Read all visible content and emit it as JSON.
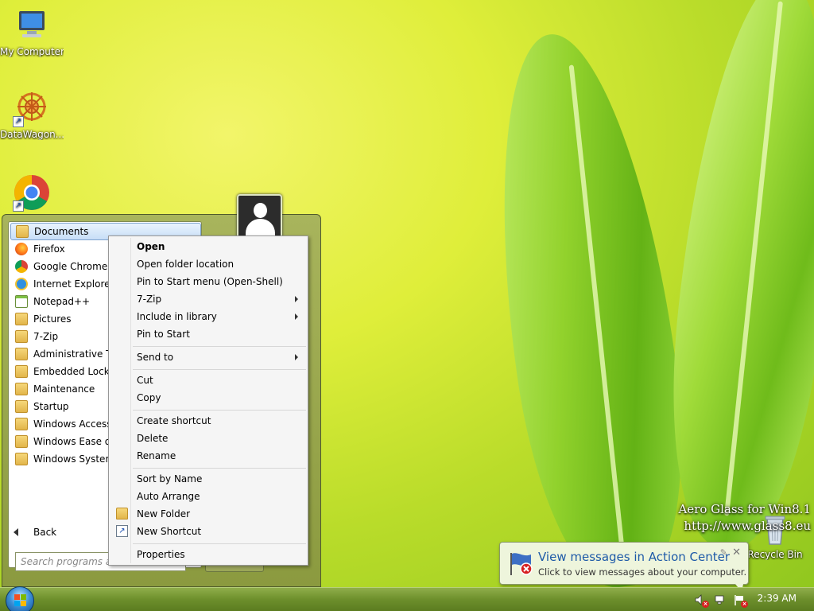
{
  "desktop": {
    "icons": [
      {
        "label": "My Computer",
        "icon": "computer-icon"
      },
      {
        "label": "DataWagon...",
        "icon": "datawagon-icon"
      },
      {
        "label": "",
        "icon": "chrome-icon"
      },
      {
        "label": "Recycle Bin",
        "icon": "recycle-bin-icon"
      }
    ],
    "watermark": {
      "line1": "Aero Glass for Win8.1",
      "line2": "http://www.glass8.eu"
    }
  },
  "start_menu": {
    "programs": [
      {
        "label": "Documents",
        "icon": "folder-icon"
      },
      {
        "label": "Firefox",
        "icon": "firefox-icon"
      },
      {
        "label": "Google Chrome",
        "icon": "chrome-icon"
      },
      {
        "label": "Internet Explorer",
        "icon": "ie-icon"
      },
      {
        "label": "Notepad++",
        "icon": "notepad-icon"
      },
      {
        "label": "Pictures",
        "icon": "folder-icon"
      },
      {
        "label": "7-Zip",
        "icon": "folder-icon"
      },
      {
        "label": "Administrative Tools",
        "icon": "folder-icon"
      },
      {
        "label": "Embedded Lockdown",
        "icon": "folder-icon"
      },
      {
        "label": "Maintenance",
        "icon": "folder-icon"
      },
      {
        "label": "Startup",
        "icon": "folder-icon"
      },
      {
        "label": "Windows Accessories",
        "icon": "folder-icon"
      },
      {
        "label": "Windows Ease of Access",
        "icon": "folder-icon"
      },
      {
        "label": "Windows System",
        "icon": "folder-icon"
      }
    ],
    "back_label": "Back",
    "search_placeholder": "Search programs and files"
  },
  "context_menu": {
    "items": [
      {
        "label": "Open"
      },
      {
        "label": "Open folder location"
      },
      {
        "label": "Pin to Start menu (Open-Shell)"
      },
      {
        "label": "7-Zip"
      },
      {
        "label": "Include in library"
      },
      {
        "label": "Pin to Start"
      },
      {
        "label": "Send to"
      },
      {
        "label": "Cut"
      },
      {
        "label": "Copy"
      },
      {
        "label": "Create shortcut"
      },
      {
        "label": "Delete"
      },
      {
        "label": "Rename"
      },
      {
        "label": "Sort by Name"
      },
      {
        "label": "Auto Arrange"
      },
      {
        "label": "New Folder"
      },
      {
        "label": "New Shortcut"
      },
      {
        "label": "Properties"
      }
    ]
  },
  "notification": {
    "title": "View messages in Action Center",
    "subtitle": "Click to view messages about your computer."
  },
  "taskbar": {
    "clock": "2:39 AM"
  }
}
